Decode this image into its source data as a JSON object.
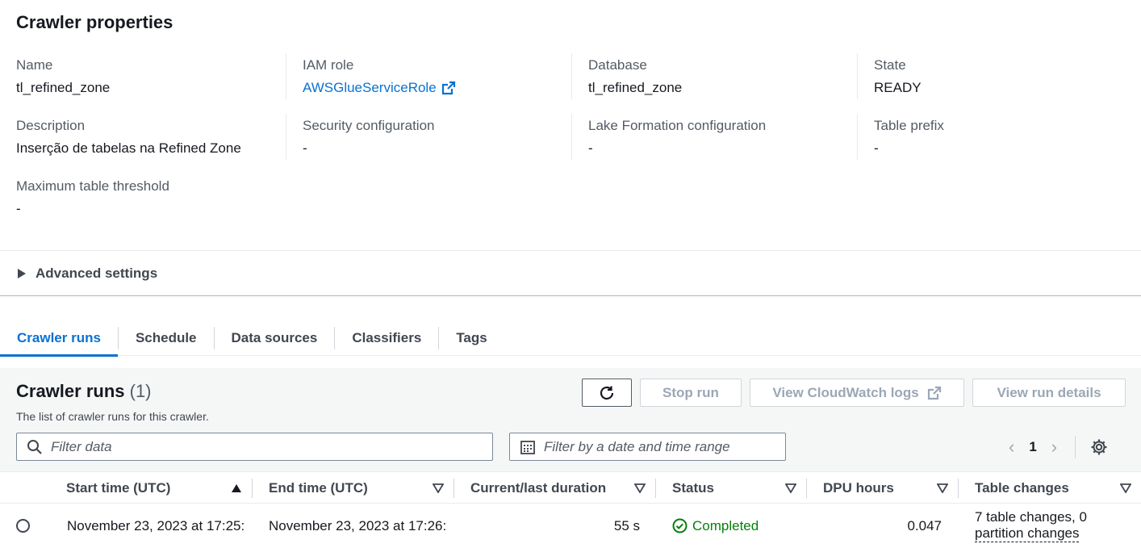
{
  "properties": {
    "title": "Crawler properties",
    "name_label": "Name",
    "name_value": "tl_refined_zone",
    "iam_label": "IAM role",
    "iam_value": "AWSGlueServiceRole",
    "database_label": "Database",
    "database_value": "tl_refined_zone",
    "state_label": "State",
    "state_value": "READY",
    "description_label": "Description",
    "description_value": "Inserção de tabelas na Refined Zone",
    "security_label": "Security configuration",
    "security_value": "-",
    "lake_label": "Lake Formation configuration",
    "lake_value": "-",
    "prefix_label": "Table prefix",
    "prefix_value": "-",
    "threshold_label": "Maximum table threshold",
    "threshold_value": "-"
  },
  "advanced": {
    "label": "Advanced settings"
  },
  "tabs": [
    "Crawler runs",
    "Schedule",
    "Data sources",
    "Classifiers",
    "Tags"
  ],
  "runs": {
    "title": "Crawler runs",
    "count": "(1)",
    "description": "The list of crawler runs for this crawler.",
    "stop_label": "Stop run",
    "logs_label": "View CloudWatch logs",
    "details_label": "View run details",
    "filter_placeholder": "Filter data",
    "date_placeholder": "Filter by a date and time range",
    "page": "1",
    "columns": [
      "Start time (UTC)",
      "End time (UTC)",
      "Current/last duration",
      "Status",
      "DPU hours",
      "Table changes"
    ],
    "rows": [
      {
        "start": "November 23, 2023 at 17:25:",
        "end": "November 23, 2023 at 17:26:",
        "duration": "55 s",
        "status": "Completed",
        "dpu": "0.047",
        "changes_line1": "7 table changes, 0",
        "changes_line2": "partition changes"
      }
    ]
  },
  "colors": {
    "accent": "#0972d3",
    "success": "#037f0c"
  }
}
